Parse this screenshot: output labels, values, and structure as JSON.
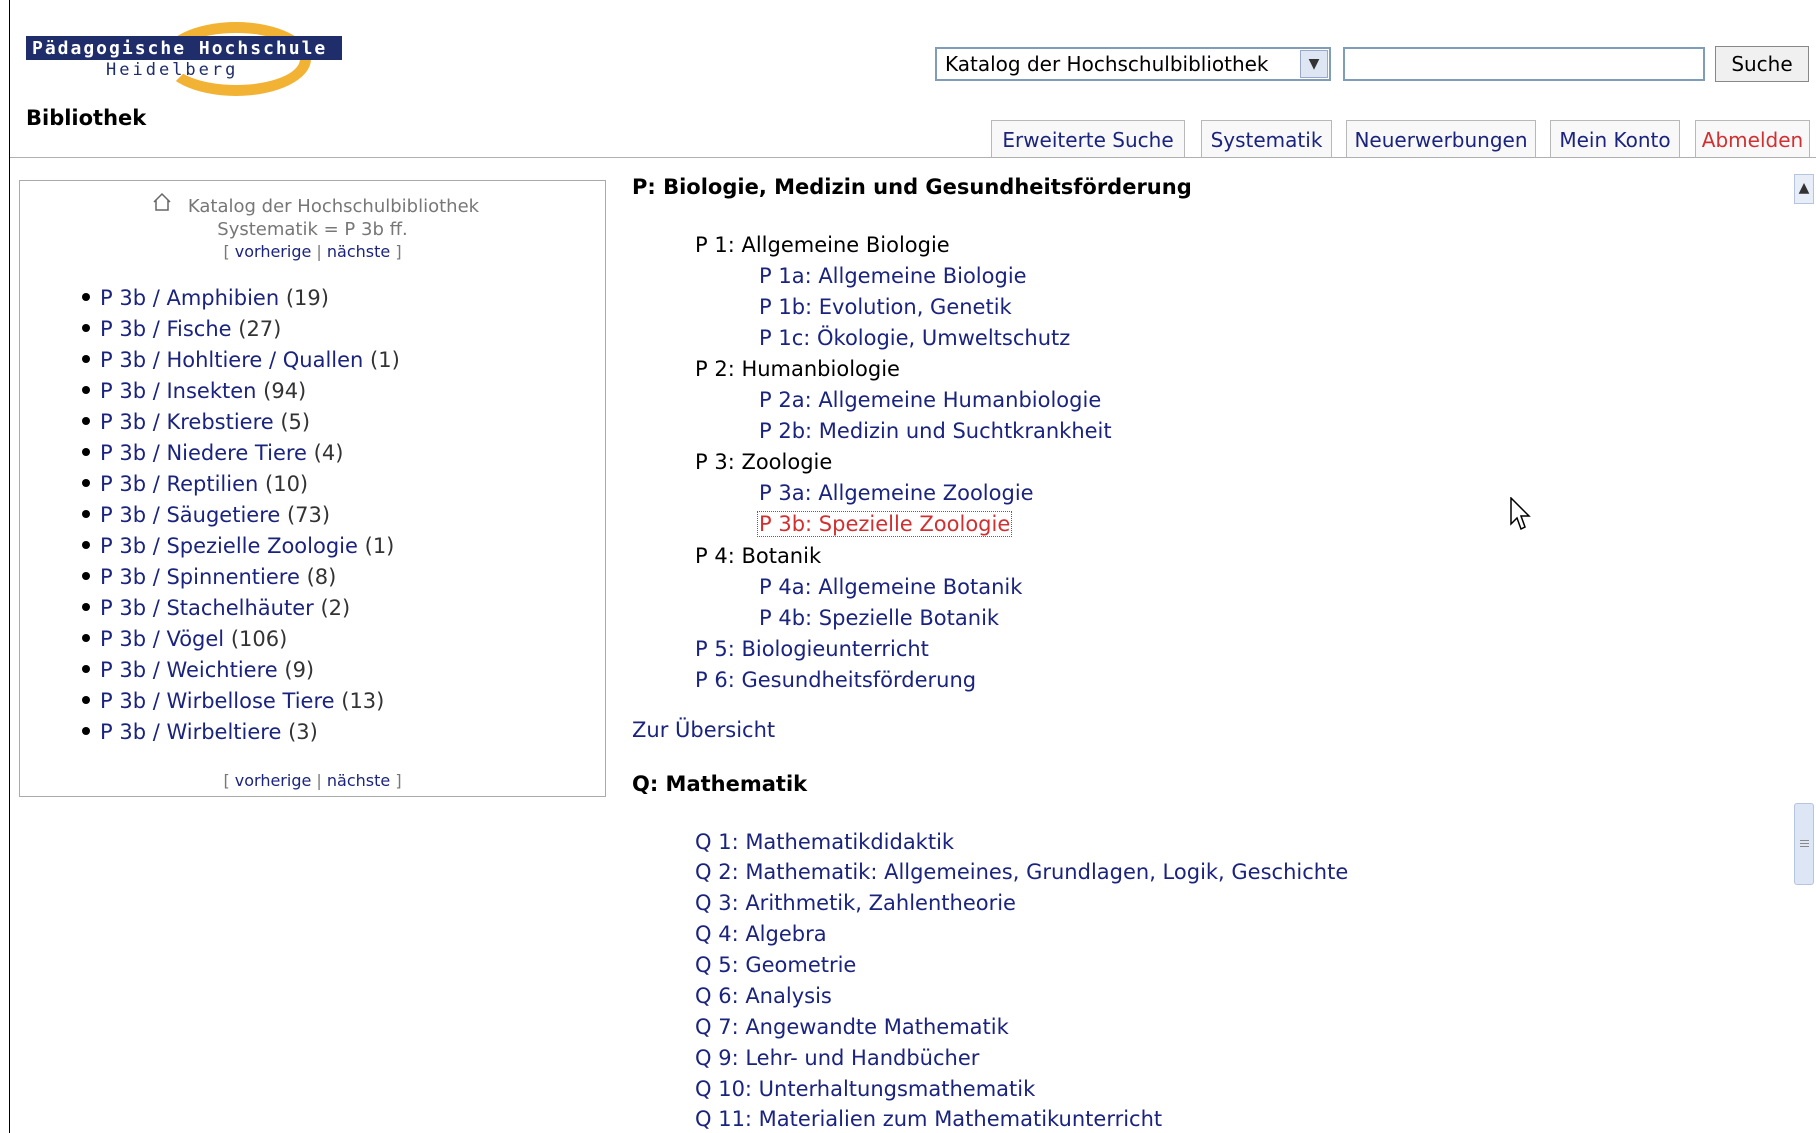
{
  "logo": {
    "line1": "Pädagogische Hochschule",
    "line2": "Heidelberg"
  },
  "app_title": "Bibliothek",
  "search": {
    "catalog_selected": "Katalog der Hochschulbibliothek",
    "query_value": "",
    "button_label": "Suche"
  },
  "tabs": [
    {
      "label": "Erweiterte Suche"
    },
    {
      "label": "Systematik"
    },
    {
      "label": "Neuerwerbungen"
    },
    {
      "label": "Mein Konto"
    },
    {
      "label": "Abmelden"
    }
  ],
  "sidebar": {
    "catalog": "Katalog der Hochschulbibliothek",
    "query": "Systematik = P 3b ff.",
    "nav_prev": "vorherige",
    "nav_next": "nächste",
    "items": [
      {
        "label": "P 3b / Amphibien",
        "count": "(19)"
      },
      {
        "label": "P 3b / Fische",
        "count": "(27)"
      },
      {
        "label": "P 3b / Hohltiere / Quallen",
        "count": "(1)"
      },
      {
        "label": "P 3b / Insekten",
        "count": "(94)"
      },
      {
        "label": "P 3b / Krebstiere",
        "count": "(5)"
      },
      {
        "label": "P 3b / Niedere Tiere",
        "count": "(4)"
      },
      {
        "label": "P 3b / Reptilien",
        "count": "(10)"
      },
      {
        "label": "P 3b / Säugetiere",
        "count": "(73)"
      },
      {
        "label": "P 3b / Spezielle Zoologie",
        "count": "(1)"
      },
      {
        "label": "P 3b / Spinnentiere",
        "count": "(8)"
      },
      {
        "label": "P 3b / Stachelhäuter",
        "count": "(2)"
      },
      {
        "label": "P 3b / Vögel",
        "count": "(106)"
      },
      {
        "label": "P 3b / Weichtiere",
        "count": "(9)"
      },
      {
        "label": "P 3b / Wirbellose Tiere",
        "count": "(13)"
      },
      {
        "label": "P 3b / Wirbeltiere",
        "count": "(3)"
      }
    ]
  },
  "main": {
    "p_heading": "P: Biologie, Medizin und Gesundheitsförderung",
    "p_entries": [
      "P 1: Allgemeine Biologie",
      "P 1a: Allgemeine Biologie",
      "P 1b: Evolution, Genetik",
      "P 1c: Ökologie, Umweltschutz",
      "P 2: Humanbiologie",
      "P 2a: Allgemeine Humanbiologie",
      "P 2b: Medizin und Suchtkrankheit",
      "P 3: Zoologie",
      "P 3a: Allgemeine Zoologie",
      "P 3b: Spezielle Zoologie",
      "P 4: Botanik",
      "P 4a: Allgemeine Botanik",
      "P 4b: Spezielle Botanik",
      "P 5: Biologieunterricht",
      "P 6: Gesundheitsförderung"
    ],
    "overview_link": "Zur Übersicht",
    "q_heading": "Q: Mathematik",
    "q_entries": [
      "Q 1: Mathematikdidaktik",
      "Q 2: Mathematik: Allgemeines, Grundlagen, Logik, Geschichte",
      "Q 3: Arithmetik, Zahlentheorie",
      "Q 4: Algebra",
      "Q 5: Geometrie",
      "Q 6: Analysis",
      "Q 7: Angewandte Mathematik",
      "Q 9: Lehr- und Handbücher",
      "Q 10: Unterhaltungsmathematik",
      "Q 11: Materialien zum Mathematikunterricht"
    ]
  },
  "colors": {
    "link": "#1a237e",
    "selected": "#d23030",
    "logo_bar": "#1f2d6b",
    "logo_swoosh": "#f2b233"
  }
}
